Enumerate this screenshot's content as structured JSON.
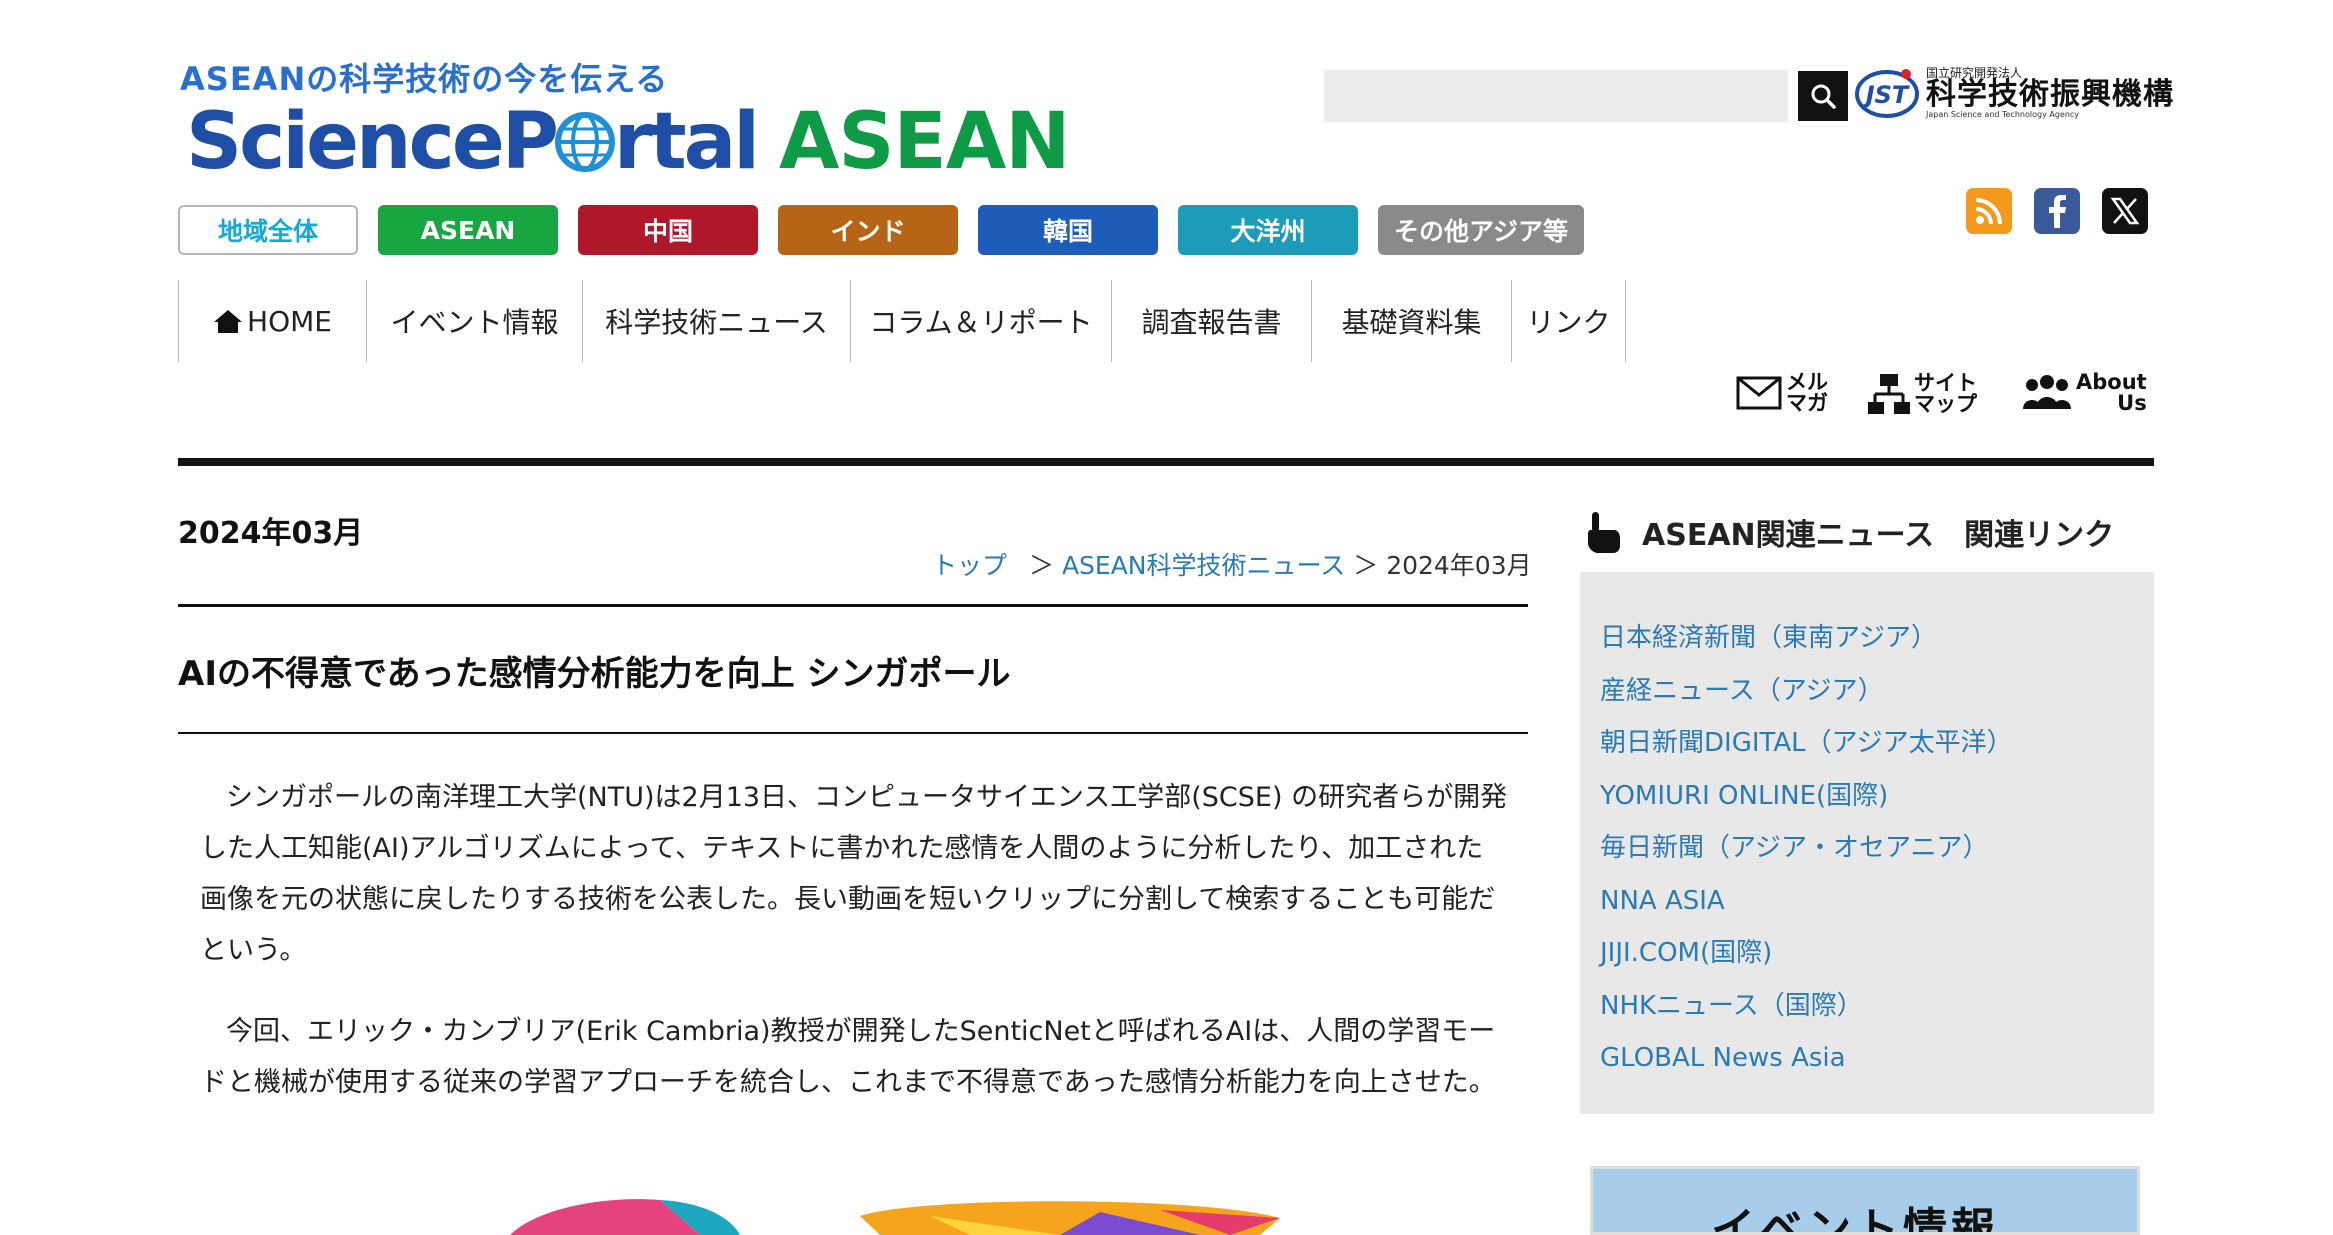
{
  "header": {
    "tagline": "ASEANの科学技術の今を伝える",
    "logo_science": "Science",
    "logo_p": "P",
    "logo_rtal": "rtal",
    "logo_asean": "ASEAN",
    "search_placeholder": "",
    "jst_small": "国立研究開発法人",
    "jst_main": "科学技術振興機構",
    "jst_en": "Japan Science and Technology Agency",
    "jst_mark": "JST"
  },
  "regions": [
    {
      "label": "地域全体",
      "bg": "#ffffff",
      "fg": "#17a9d6",
      "border": "#b5b5b5",
      "width": 180
    },
    {
      "label": "ASEAN",
      "bg": "#17a642",
      "fg": "#ffffff",
      "border": "#17a642",
      "width": 180
    },
    {
      "label": "中国",
      "bg": "#b0172a",
      "fg": "#ffffff",
      "border": "#b0172a",
      "width": 180
    },
    {
      "label": "インド",
      "bg": "#b56515",
      "fg": "#ffffff",
      "border": "#b56515",
      "width": 180
    },
    {
      "label": "韓国",
      "bg": "#1d5cb8",
      "fg": "#ffffff",
      "border": "#1d5cb8",
      "width": 180
    },
    {
      "label": "大洋州",
      "bg": "#1c9cb8",
      "fg": "#ffffff",
      "border": "#1c9cb8",
      "width": 180
    },
    {
      "label": "その他アジア等",
      "bg": "#8a8a8a",
      "fg": "#ffffff",
      "border": "#8a8a8a",
      "width": 206
    }
  ],
  "nav": [
    {
      "label": "HOME",
      "width": 188
    },
    {
      "label": "イベント情報",
      "width": 216
    },
    {
      "label": "科学技術ニュース",
      "width": 268
    },
    {
      "label": "コラム＆リポート",
      "width": 261
    },
    {
      "label": "調査報告書",
      "width": 200
    },
    {
      "label": "基礎資料集",
      "width": 200
    },
    {
      "label": "リンク",
      "width": 114
    }
  ],
  "utils": {
    "mail_line1": "メル",
    "mail_line2": "マガ",
    "sitemap_line1": "サイト",
    "sitemap_line2": "マップ",
    "about_line1": "About",
    "about_line2": "Us"
  },
  "main": {
    "date_heading": "2024年03月",
    "breadcrumb_top": "トップ",
    "breadcrumb_sep1": "＞",
    "breadcrumb_news": "ASEAN科学技術ニュース",
    "breadcrumb_sep2": "＞",
    "breadcrumb_current": "2024年03月",
    "title": "AIの不得意であった感情分析能力を向上 シンガポール",
    "para1": "シンガポールの南洋理工大学(NTU)は2月13日、コンピュータサイエンス工学部(SCSE) の研究者らが開発した人工知能(AI)アルゴリズムによって、テキストに書かれた感情を人間のように分析したり、加工された画像を元の状態に戻したりする技術を公表した。長い動画を短いクリップに分割して検索することも可能だという。",
    "para2": "今回、エリック・カンブリア(Erik Cambria)教授が開発したSenticNetと呼ばれるAIは、人間の学習モードと機械が使用する従来の学習アプローチを統合し、これまで不得意であった感情分析能力を向上させた。"
  },
  "sidebar": {
    "heading": "ASEAN関連ニュース　関連リンク",
    "links": [
      "日本経済新聞（東南アジア）",
      "産経ニュース（アジア）",
      "朝日新聞DIGITAL（アジア太平洋）",
      "YOMIURI ONLINE(国際)",
      "毎日新聞（アジア・オセアニア）",
      "NNA ASIA",
      "JIJI.COM(国際)",
      "NHKニュース（国際）",
      "GLOBAL News Asia"
    ],
    "event_banner": "イベント情報"
  }
}
